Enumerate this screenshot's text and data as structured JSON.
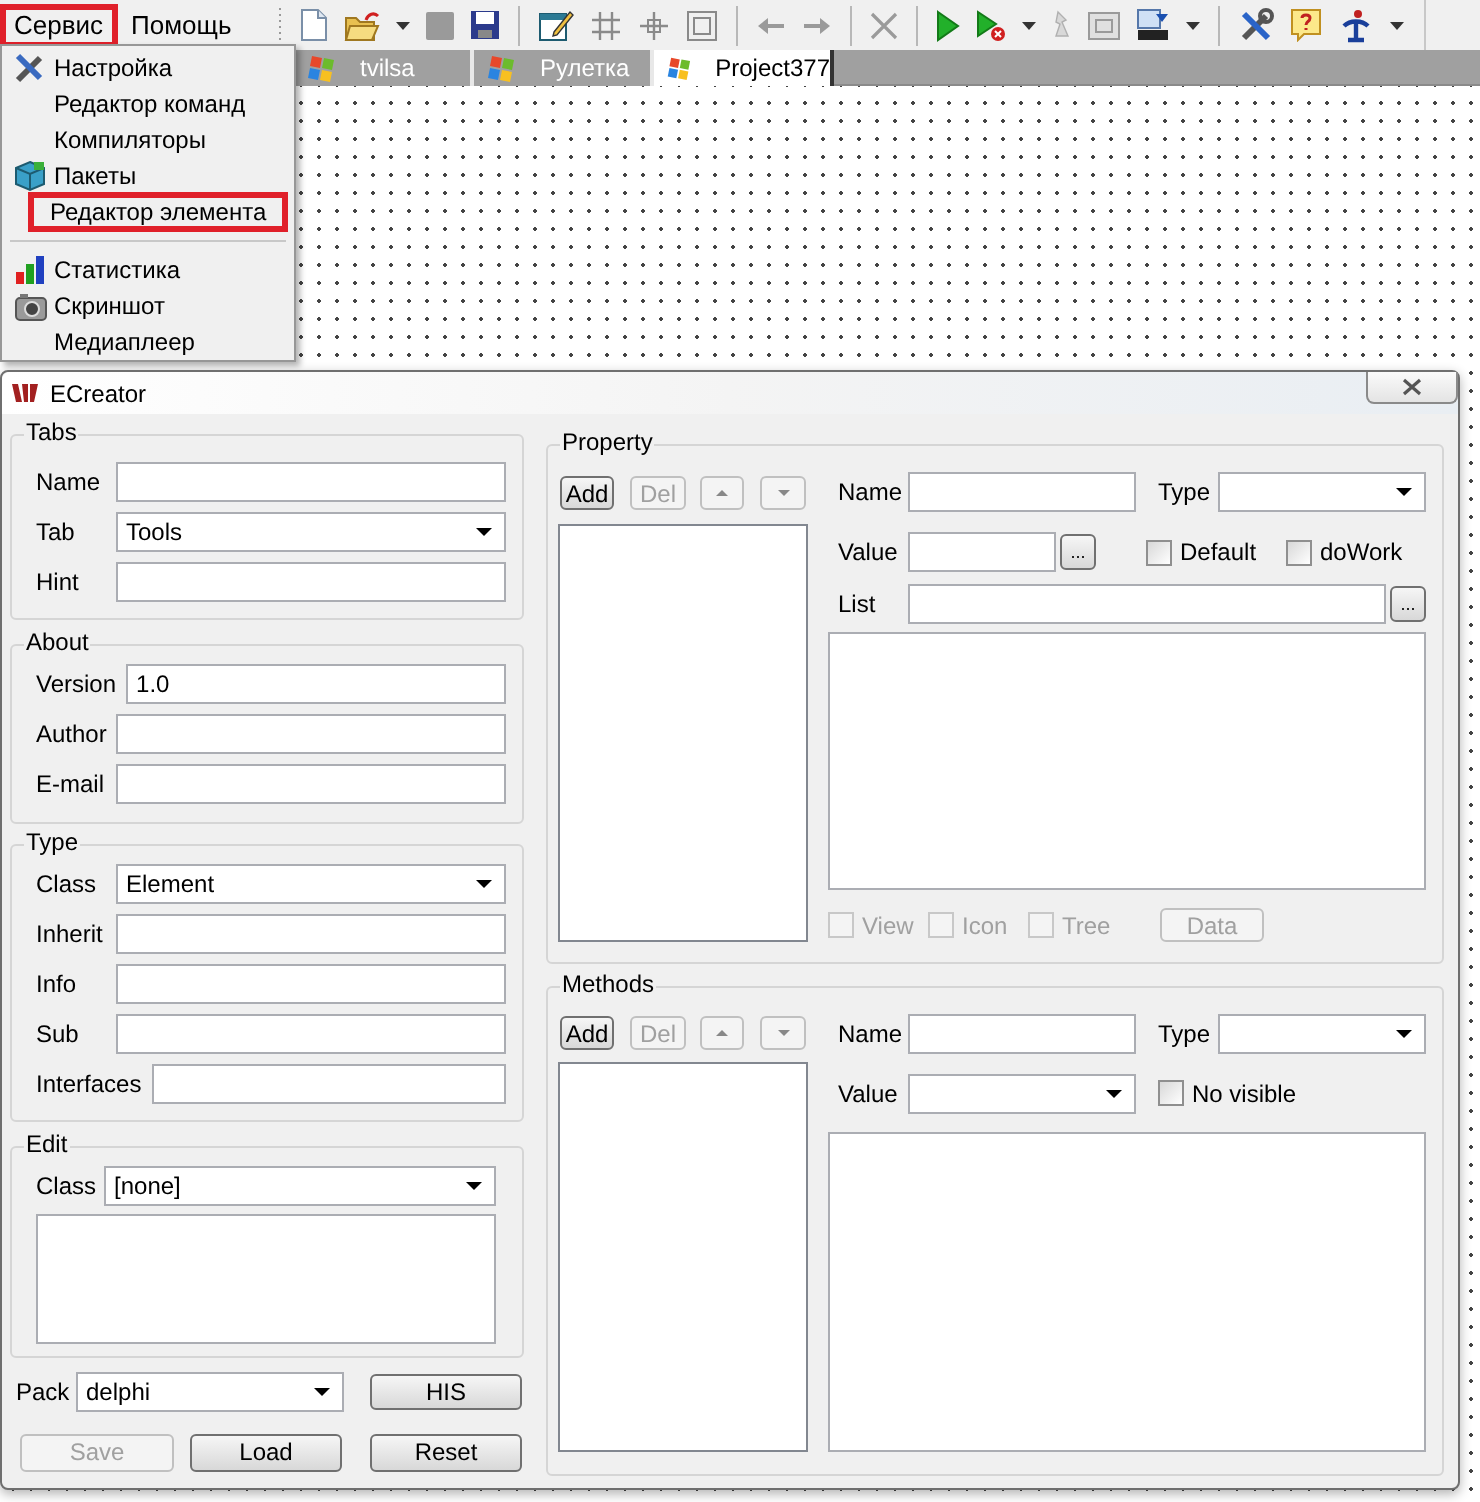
{
  "menubar": [
    {
      "label": "Сервис",
      "selected": true
    },
    {
      "label": "Помощь",
      "selected": false
    }
  ],
  "editor_tabs": [
    {
      "label": "tvilsa",
      "selected": false
    },
    {
      "label": "Рулетка",
      "selected": false
    },
    {
      "label": "Project377",
      "selected": true
    }
  ],
  "menu": [
    {
      "kind": "item",
      "label": "Настройка",
      "highlighted": false
    },
    {
      "kind": "item",
      "label": "Редактор команд",
      "highlighted": false
    },
    {
      "kind": "item",
      "label": "Компиляторы",
      "highlighted": false
    },
    {
      "kind": "item",
      "label": "Пакеты",
      "highlighted": false
    },
    {
      "kind": "item",
      "label": "Редактор элемента",
      "highlighted": true
    },
    {
      "kind": "separator"
    },
    {
      "kind": "item",
      "label": "Статистика",
      "highlighted": false
    },
    {
      "kind": "item",
      "label": "Скриншот",
      "highlighted": false
    },
    {
      "kind": "item",
      "label": "Медиаплеер",
      "highlighted": false
    }
  ],
  "dialog": {
    "title": "ECreator",
    "left_groups": [
      {
        "title": "Tabs",
        "fields": [
          {
            "kind": "text",
            "label": "Name"
          },
          {
            "kind": "combo",
            "label": "Tab",
            "value": "Tools"
          },
          {
            "kind": "text",
            "label": "Hint"
          }
        ]
      },
      {
        "title": "About",
        "fields": [
          {
            "kind": "text",
            "label": "Version",
            "value": "1.0"
          },
          {
            "kind": "text",
            "label": "Author"
          },
          {
            "kind": "text",
            "label": "E-mail"
          }
        ]
      },
      {
        "title": "Type",
        "fields": [
          {
            "kind": "combo",
            "label": "Class",
            "value": "Element"
          },
          {
            "kind": "text",
            "label": "Inherit"
          },
          {
            "kind": "text",
            "label": "Info"
          },
          {
            "kind": "text",
            "label": "Sub"
          },
          {
            "kind": "text",
            "label": "Interfaces"
          }
        ]
      }
    ],
    "edit_group": {
      "title": "Edit",
      "class_label": "Class",
      "class_value": "[none]"
    },
    "pack": {
      "label": "Pack",
      "value": "delphi"
    },
    "his_button": {
      "label": "HIS",
      "disabled": false
    },
    "bottom_buttons": [
      {
        "label": "Save",
        "disabled": true
      },
      {
        "label": "Load",
        "disabled": false
      },
      {
        "label": "Reset",
        "disabled": false
      }
    ],
    "property": {
      "title": "Property",
      "list_buttons": [
        {
          "label": "Add",
          "disabled": false
        },
        {
          "label": "Del",
          "disabled": true
        }
      ],
      "name_label": "Name",
      "type_label": "Type",
      "value_label": "Value",
      "value_browse": "...",
      "list_label": "List",
      "list_browse": "...",
      "options": [
        {
          "label": "Default",
          "checked": false,
          "disabled": false
        },
        {
          "label": "doWork",
          "checked": false,
          "disabled": false
        }
      ],
      "view_options": [
        {
          "label": "View",
          "checked": false,
          "disabled": true
        },
        {
          "label": "Icon",
          "checked": false,
          "disabled": true
        },
        {
          "label": "Tree",
          "checked": false,
          "disabled": true
        }
      ],
      "data_button": {
        "label": "Data",
        "disabled": true
      }
    },
    "methods": {
      "title": "Methods",
      "list_buttons": [
        {
          "label": "Add",
          "disabled": false
        },
        {
          "label": "Del",
          "disabled": true
        }
      ],
      "name_label": "Name",
      "type_label": "Type",
      "value_label": "Value",
      "options": [
        {
          "label": "No visible",
          "checked": false,
          "disabled": false
        }
      ]
    }
  }
}
